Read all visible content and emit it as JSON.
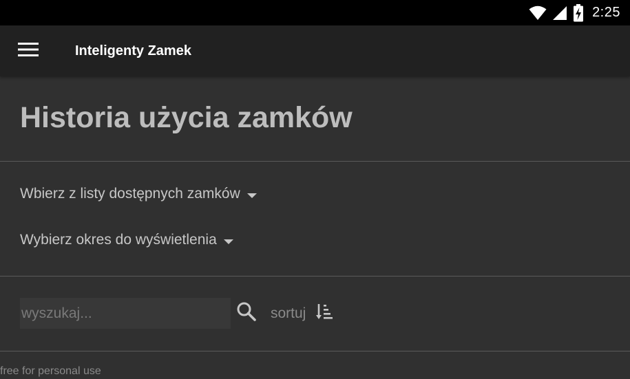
{
  "status_bar": {
    "time": "2:25",
    "icons": [
      "wifi-icon",
      "signal-icon",
      "battery-charging-icon"
    ]
  },
  "app_bar": {
    "menu_icon": "hamburger-menu-icon",
    "title": "Inteligenty Zamek"
  },
  "main": {
    "page_title": "Historia użycia zamków",
    "lock_select": {
      "label": "Wbierz z listy dostępnych zamków"
    },
    "period_select": {
      "label": "Wybierz okres do wyświetlenia"
    },
    "search": {
      "value": "",
      "placeholder": "wyszukaj...",
      "icon": "search-icon"
    },
    "sort": {
      "label": "sortuj",
      "icon": "sort-icon"
    },
    "footer_note": "free for personal use"
  },
  "colors": {
    "status_bar_bg": "#000000",
    "app_bar_bg": "#212121",
    "page_bg": "#303030",
    "title_text": "#bdbdbd",
    "divider": "#5a5a5a"
  }
}
